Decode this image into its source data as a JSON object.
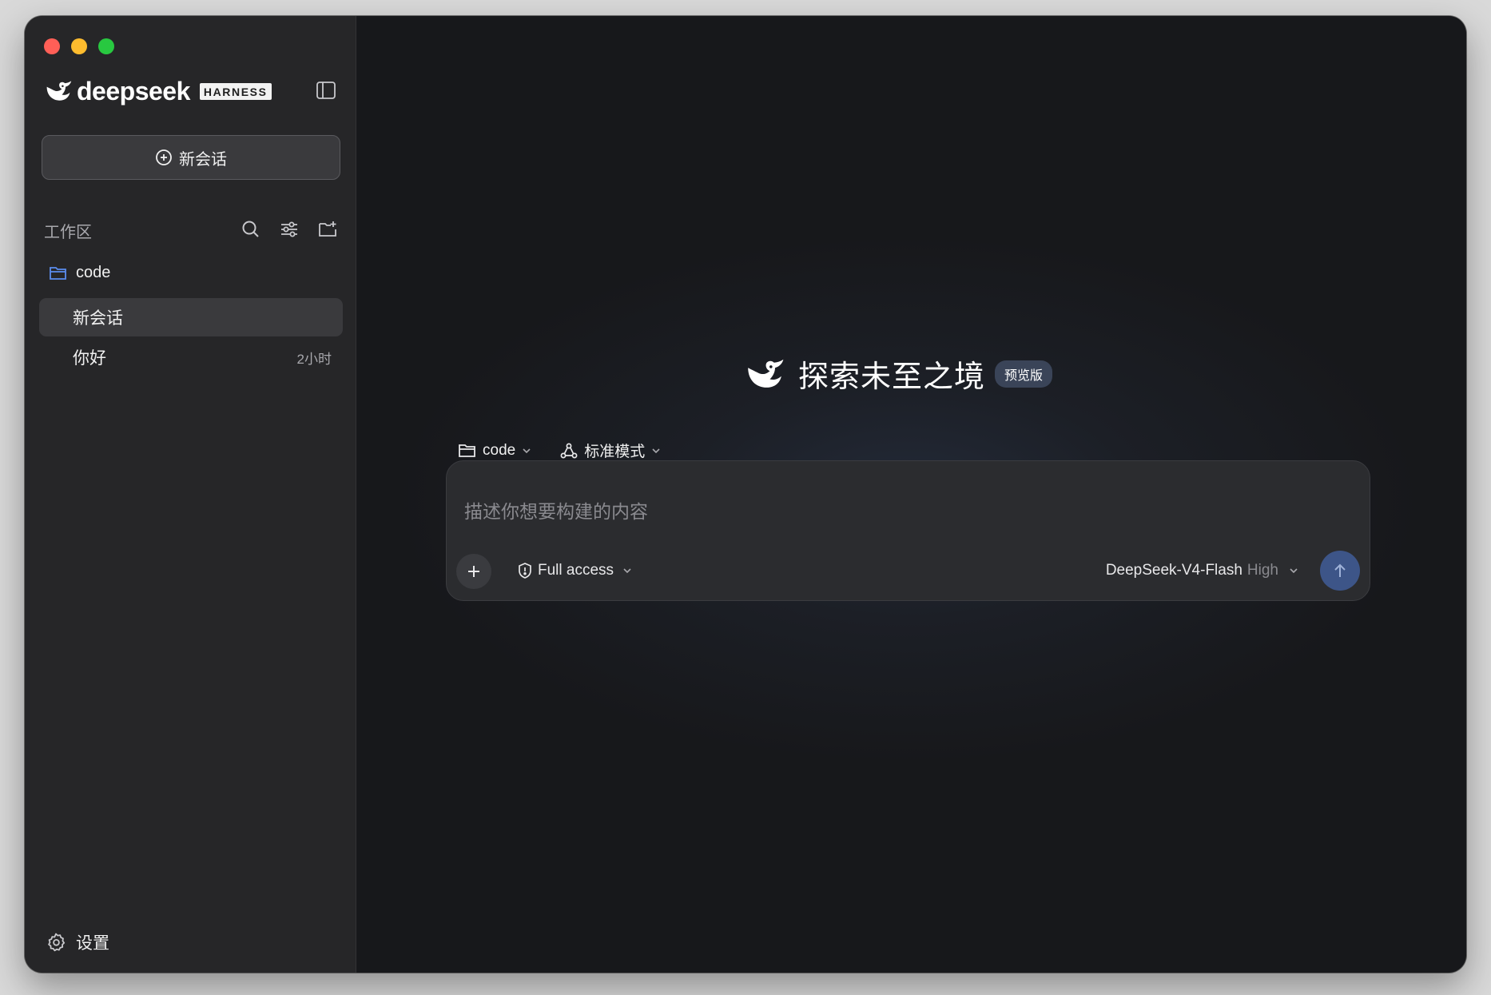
{
  "window_controls": [
    "close",
    "minimize",
    "maximize"
  ],
  "brand": {
    "logo_icon": "deepseek-whale-icon",
    "wordmark": "deepseek",
    "badge": "HARNESS"
  },
  "sidebar": {
    "toggle_icon": "sidebar-toggle-icon",
    "new_chat_label": "新会话",
    "workspace_title": "工作区",
    "tools": [
      "search-icon",
      "filter-icon",
      "new-folder-icon"
    ],
    "folder": {
      "icon": "folder-icon",
      "name": "code"
    },
    "chats": [
      {
        "title": "新会话",
        "time": "",
        "active": true
      },
      {
        "title": "你好",
        "time": "2小时",
        "active": false
      }
    ],
    "settings_label": "设置"
  },
  "main": {
    "slogan": "探索未至之境",
    "preview_badge": "预览版",
    "folder_selector": "code",
    "mode_selector": "标准模式",
    "composer": {
      "placeholder": "描述你想要构建的内容",
      "access_label": "Full access",
      "model_name": "DeepSeek-V4-Flash",
      "model_level": "High"
    }
  },
  "colors": {
    "accent_send": "#3d5588",
    "folder_blue": "#5b8def",
    "sidebar_bg": "#262628",
    "main_bg": "#17181b"
  }
}
